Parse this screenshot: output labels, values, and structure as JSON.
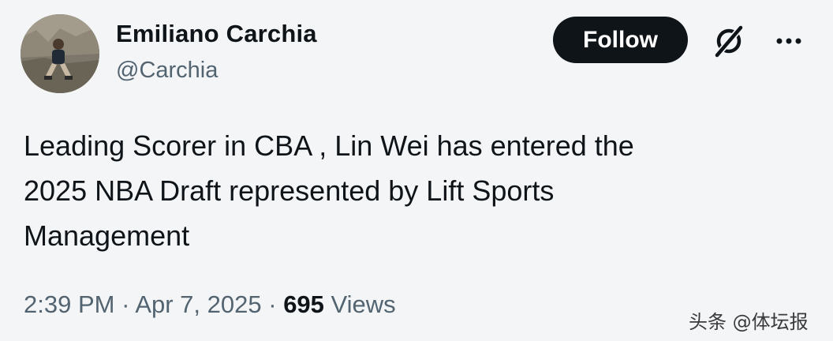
{
  "author": {
    "display_name": "Emiliano Carchia",
    "handle": "@Carchia"
  },
  "actions": {
    "follow_label": "Follow",
    "grok_icon": "grok-icon",
    "more_icon": "more-horizontal-icon"
  },
  "tweet": {
    "text_lines": [
      "Leading Scorer in CBA , Lin Wei has entered the",
      "2025 NBA Draft represented by Lift Sports",
      "Management"
    ],
    "time": "2:39 PM",
    "separator": "·",
    "date": "Apr 7, 2025",
    "views_count": "695",
    "views_label": "Views"
  },
  "watermark": "头条 @体坛报",
  "colors": {
    "background": "#f4f5f7",
    "primary_text": "#0f1419",
    "secondary_text": "#536471",
    "follow_button_bg": "#0f1419",
    "follow_button_text": "#ffffff"
  }
}
